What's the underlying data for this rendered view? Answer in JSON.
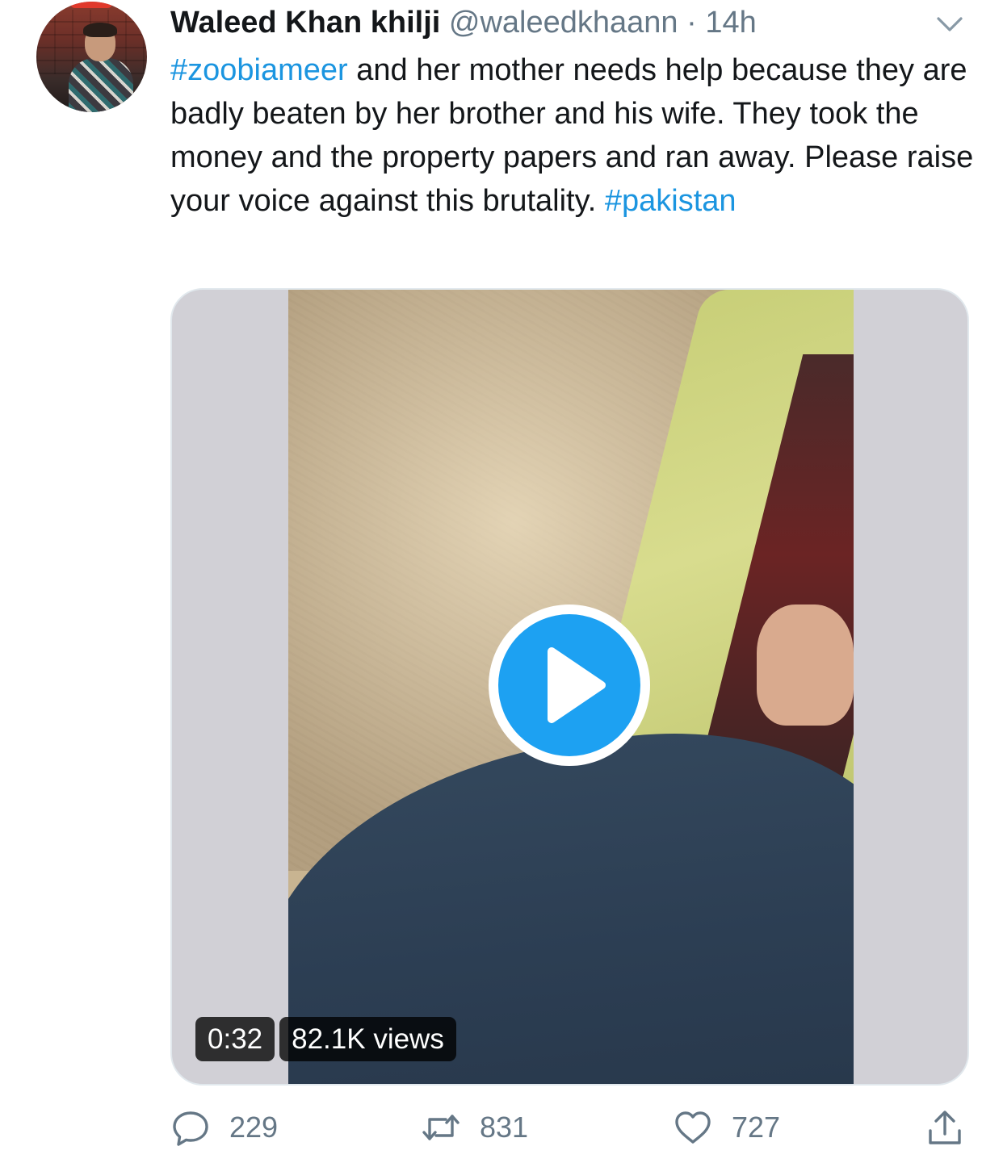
{
  "tweet": {
    "author": {
      "display_name": "Waleed Khan khilji",
      "handle": "@waleedkhaann",
      "separator": "·",
      "time": "14h"
    },
    "text": {
      "hashtag1": "#zoobiameer",
      "body": " and her mother needs help because they are badly beaten by her brother and his wife. They took the money and the property papers and ran away. Please raise your voice against this brutality. ",
      "hashtag2": "#pakistan"
    },
    "media": {
      "duration": "0:32",
      "views": "82.1K views"
    },
    "actions": {
      "replies": "229",
      "retweets": "831",
      "likes": "727"
    }
  },
  "icons": {
    "menu": "chevron-down-icon",
    "reply": "reply-icon",
    "retweet": "retweet-icon",
    "like": "heart-icon",
    "share": "share-icon",
    "play": "play-icon"
  },
  "colors": {
    "link": "#1b95e0",
    "secondary_text": "#657786",
    "play_button": "#1da1f2"
  }
}
